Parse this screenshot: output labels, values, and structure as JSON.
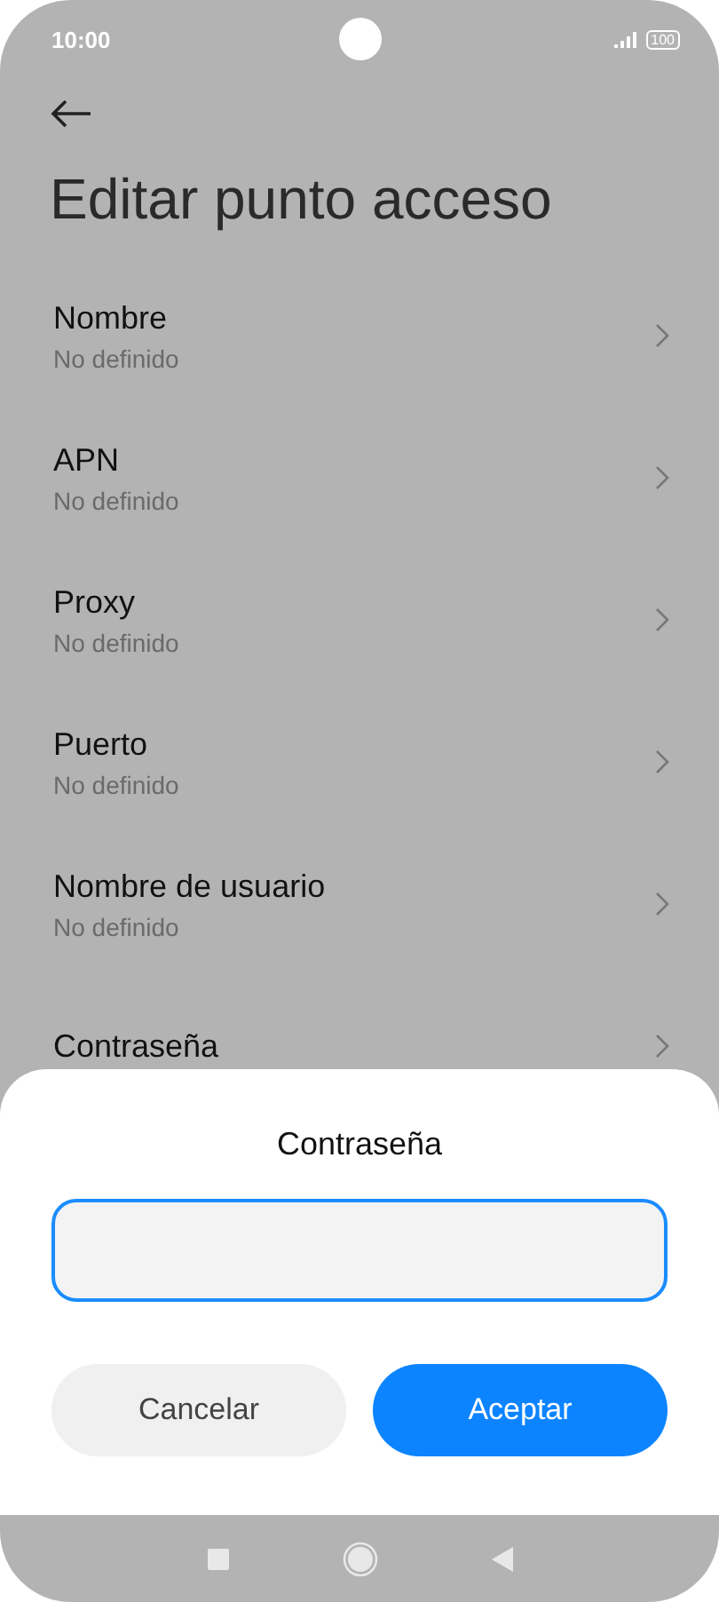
{
  "status_bar": {
    "time": "10:00",
    "battery": "100"
  },
  "title": "Editar punto acceso",
  "items": [
    {
      "label": "Nombre",
      "value": "No definido"
    },
    {
      "label": "APN",
      "value": "No definido"
    },
    {
      "label": "Proxy",
      "value": "No definido"
    },
    {
      "label": "Puerto",
      "value": "No definido"
    },
    {
      "label": "Nombre de usuario",
      "value": "No definido"
    },
    {
      "label": "Contraseña"
    }
  ],
  "dialog": {
    "title": "Contraseña",
    "buttons": [
      {
        "label": "Cancelar",
        "kind": "secondary"
      },
      {
        "label": "Aceptar",
        "kind": "primary"
      }
    ]
  }
}
